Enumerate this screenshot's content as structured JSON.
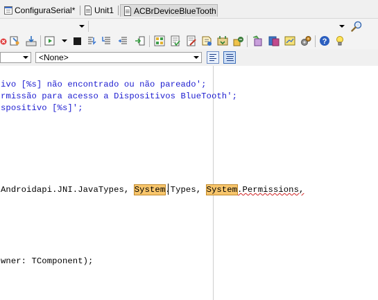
{
  "tabs": [
    {
      "label": "ConfiguraSerial*",
      "icon": "form-icon",
      "active": false
    },
    {
      "label": "Unit1",
      "icon": "unit-file-icon",
      "active": false
    },
    {
      "label": "ACBrDeviceBlueTooth",
      "icon": "unit-file-icon",
      "active": true
    }
  ],
  "toolbar": {
    "combo_value": "",
    "search_icon": "search-icon",
    "buttons_row2": [
      "close-icon",
      "compile-icon",
      "install-icon",
      "run-icon",
      "stop-icon",
      "step-over-icon",
      "trace-into-icon",
      "run-to-cursor-icon",
      "tile-icon",
      "commit-icon",
      "revert-icon",
      "attach-icon",
      "detach-icon",
      "deploy-icon",
      "packages-icon",
      "options-icon",
      "help-icon",
      "tip-icon"
    ]
  },
  "navbar": {
    "class_combo": "",
    "method_combo": "<None>",
    "align_left_label": "align-left-icon",
    "align_center_label": "align-center-icon"
  },
  "code": {
    "line1": "ivo [%s] não encontrado ou não pareado';",
    "line2": "rmissão para acesso a Dispositivos BlueTooth';",
    "line3": "spositivo [%s]';",
    "uses_prefix": "Androidapi.JNI.JavaTypes, ",
    "uses_sys1": "System",
    "uses_mid": ".Types, ",
    "uses_sys2": "System",
    "uses_suffix": ".Permissions,",
    "ctor_line": "wner: TComponent);"
  }
}
